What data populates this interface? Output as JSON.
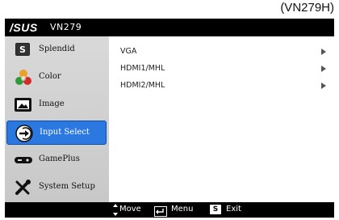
{
  "model_tag": "(VN279H)",
  "titlebar": {
    "brand": "/SUS",
    "model": "VN279"
  },
  "sidebar": {
    "items": [
      {
        "label": "Splendid",
        "icon": "splendid-s-icon"
      },
      {
        "label": "Color",
        "icon": "color-triangle-icon"
      },
      {
        "label": "Image",
        "icon": "image-frame-icon"
      },
      {
        "label": "Input Select",
        "icon": "input-select-icon",
        "active": true
      },
      {
        "label": "GamePlus",
        "icon": "gamepad-icon"
      },
      {
        "label": "System Setup",
        "icon": "tools-icon"
      }
    ]
  },
  "inputs": {
    "options": [
      {
        "label": "VGA"
      },
      {
        "label": "HDMI1/MHL"
      },
      {
        "label": "HDMI2/MHL"
      }
    ]
  },
  "footer": {
    "move_label": "Move",
    "menu_label": "Menu",
    "exit_label": "Exit",
    "exit_key": "S"
  },
  "colors": {
    "accent": "#2b79e0",
    "osd_bg": "#000000",
    "sidebar_bg": "#d0d0d0"
  }
}
